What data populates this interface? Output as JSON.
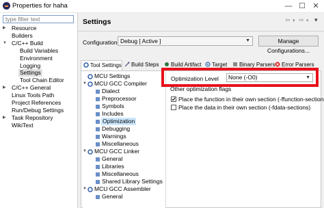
{
  "window": {
    "title": "Properties for haha",
    "minimize": "—",
    "maximize": "☐",
    "close": "✕"
  },
  "left": {
    "filter_placeholder": "type filter text",
    "items": [
      {
        "label": "Resource"
      },
      {
        "label": "Builders"
      },
      {
        "label": "C/C++ Build"
      },
      {
        "label": "Build Variables"
      },
      {
        "label": "Environment"
      },
      {
        "label": "Logging"
      },
      {
        "label": "Settings"
      },
      {
        "label": "Tool Chain Editor"
      },
      {
        "label": "C/C++ General"
      },
      {
        "label": "Linux Tools Path"
      },
      {
        "label": "Project References"
      },
      {
        "label": "Run/Debug Settings"
      },
      {
        "label": "Task Repository"
      },
      {
        "label": "WikiText"
      }
    ]
  },
  "header": {
    "title": "Settings",
    "back": "⇦",
    "forward": "⇨",
    "menu": "▾"
  },
  "config": {
    "label": "Configuration:",
    "value": "Debug  [ Active ]",
    "manage_label": "Manage Configurations..."
  },
  "tabs": [
    {
      "label": "Tool Settings"
    },
    {
      "label": "Build Steps"
    },
    {
      "label": "Build Artifact"
    },
    {
      "label": "Target"
    },
    {
      "label": "Binary Parsers"
    },
    {
      "label": "Error Parsers"
    }
  ],
  "tool_tree": [
    {
      "label": "MCU Settings"
    },
    {
      "label": "MCU GCC Compiler"
    },
    {
      "label": "Dialect"
    },
    {
      "label": "Preprocessor"
    },
    {
      "label": "Symbols"
    },
    {
      "label": "Includes"
    },
    {
      "label": "Optimization"
    },
    {
      "label": "Debugging"
    },
    {
      "label": "Warnings"
    },
    {
      "label": "Miscellaneous"
    },
    {
      "label": "MCU GCC Linker"
    },
    {
      "label": "General"
    },
    {
      "label": "Libraries"
    },
    {
      "label": "Miscellaneous"
    },
    {
      "label": "Shared Library Settings"
    },
    {
      "label": "MCU GCC Assembler"
    },
    {
      "label": "General"
    }
  ],
  "optimization": {
    "level_label": "Optimization Level",
    "level_value": "None (-O0)",
    "other_flags_label": "Other optimization flags",
    "function_sections_label": "Place the function in their own section (-ffunction-sections)",
    "function_sections_checked": true,
    "data_sections_label": "Place the data in their own section (-fdata-sections)",
    "data_sections_checked": false
  },
  "colors": {
    "highlight_box": "#e8101a",
    "selection": "#cde8ff"
  }
}
